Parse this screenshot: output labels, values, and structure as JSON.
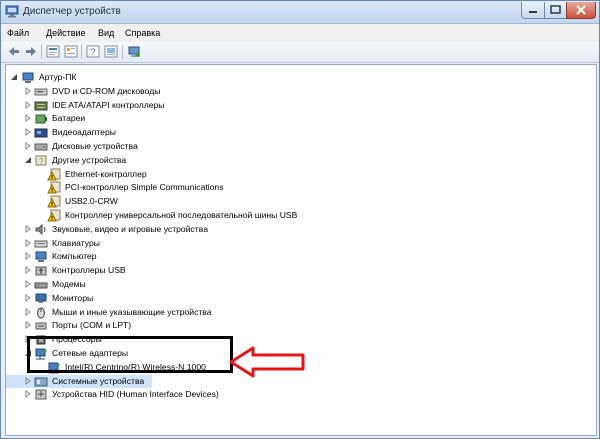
{
  "window": {
    "title": "Диспетчер устройств"
  },
  "menu": {
    "items": [
      "Файл",
      "Действие",
      "Вид",
      "Справка"
    ]
  },
  "toolbar": {
    "buttons": [
      "back-icon",
      "forward-icon",
      "properties-icon",
      "help-icon",
      "scan-icon",
      "device-icon"
    ]
  },
  "tree": {
    "root": "Артур-ПК",
    "items": [
      {
        "label": "DVD и CD-ROM дисководы",
        "icon": "dvd-drive-icon"
      },
      {
        "label": "IDE ATA/ATAPI контроллеры",
        "icon": "ide-controller-icon"
      },
      {
        "label": "Батареи",
        "icon": "battery-icon"
      },
      {
        "label": "Видеоадаптеры",
        "icon": "display-adapter-icon"
      },
      {
        "label": "Дисковые устройства",
        "icon": "disk-drive-icon"
      },
      {
        "label": "Другие устройства",
        "icon": "other-devices-icon"
      },
      {
        "label": "Ethernet-контроллер",
        "icon": "warning-device-icon"
      },
      {
        "label": "PCI-контроллер Simple Communications",
        "icon": "warning-device-icon"
      },
      {
        "label": "USB2.0-CRW",
        "icon": "warning-device-icon"
      },
      {
        "label": "Контроллер универсальной последовательной шины USB",
        "icon": "warning-device-icon"
      },
      {
        "label": "Звуковые, видео и игровые устройства",
        "icon": "sound-icon"
      },
      {
        "label": "Клавиатуры",
        "icon": "keyboard-icon"
      },
      {
        "label": "Компьютер",
        "icon": "computer-icon"
      },
      {
        "label": "Контроллеры USB",
        "icon": "usb-icon"
      },
      {
        "label": "Модемы",
        "icon": "modem-icon"
      },
      {
        "label": "Мониторы",
        "icon": "monitor-icon"
      },
      {
        "label": "Мыши и иные указывающие устройства",
        "icon": "mouse-icon"
      },
      {
        "label": "Порты (COM и LPT)",
        "icon": "port-icon"
      },
      {
        "label": "Процессоры",
        "icon": "processor-icon"
      },
      {
        "label": "Сетевые адаптеры",
        "icon": "network-adapter-icon"
      },
      {
        "label": "Intel(R) Centrino(R) Wireless-N 1000",
        "icon": "network-adapter-icon"
      },
      {
        "label": "Системные устройства",
        "icon": "system-device-icon"
      },
      {
        "label": "Устройства HID (Human Interface Devices)",
        "icon": "hid-icon"
      }
    ]
  }
}
